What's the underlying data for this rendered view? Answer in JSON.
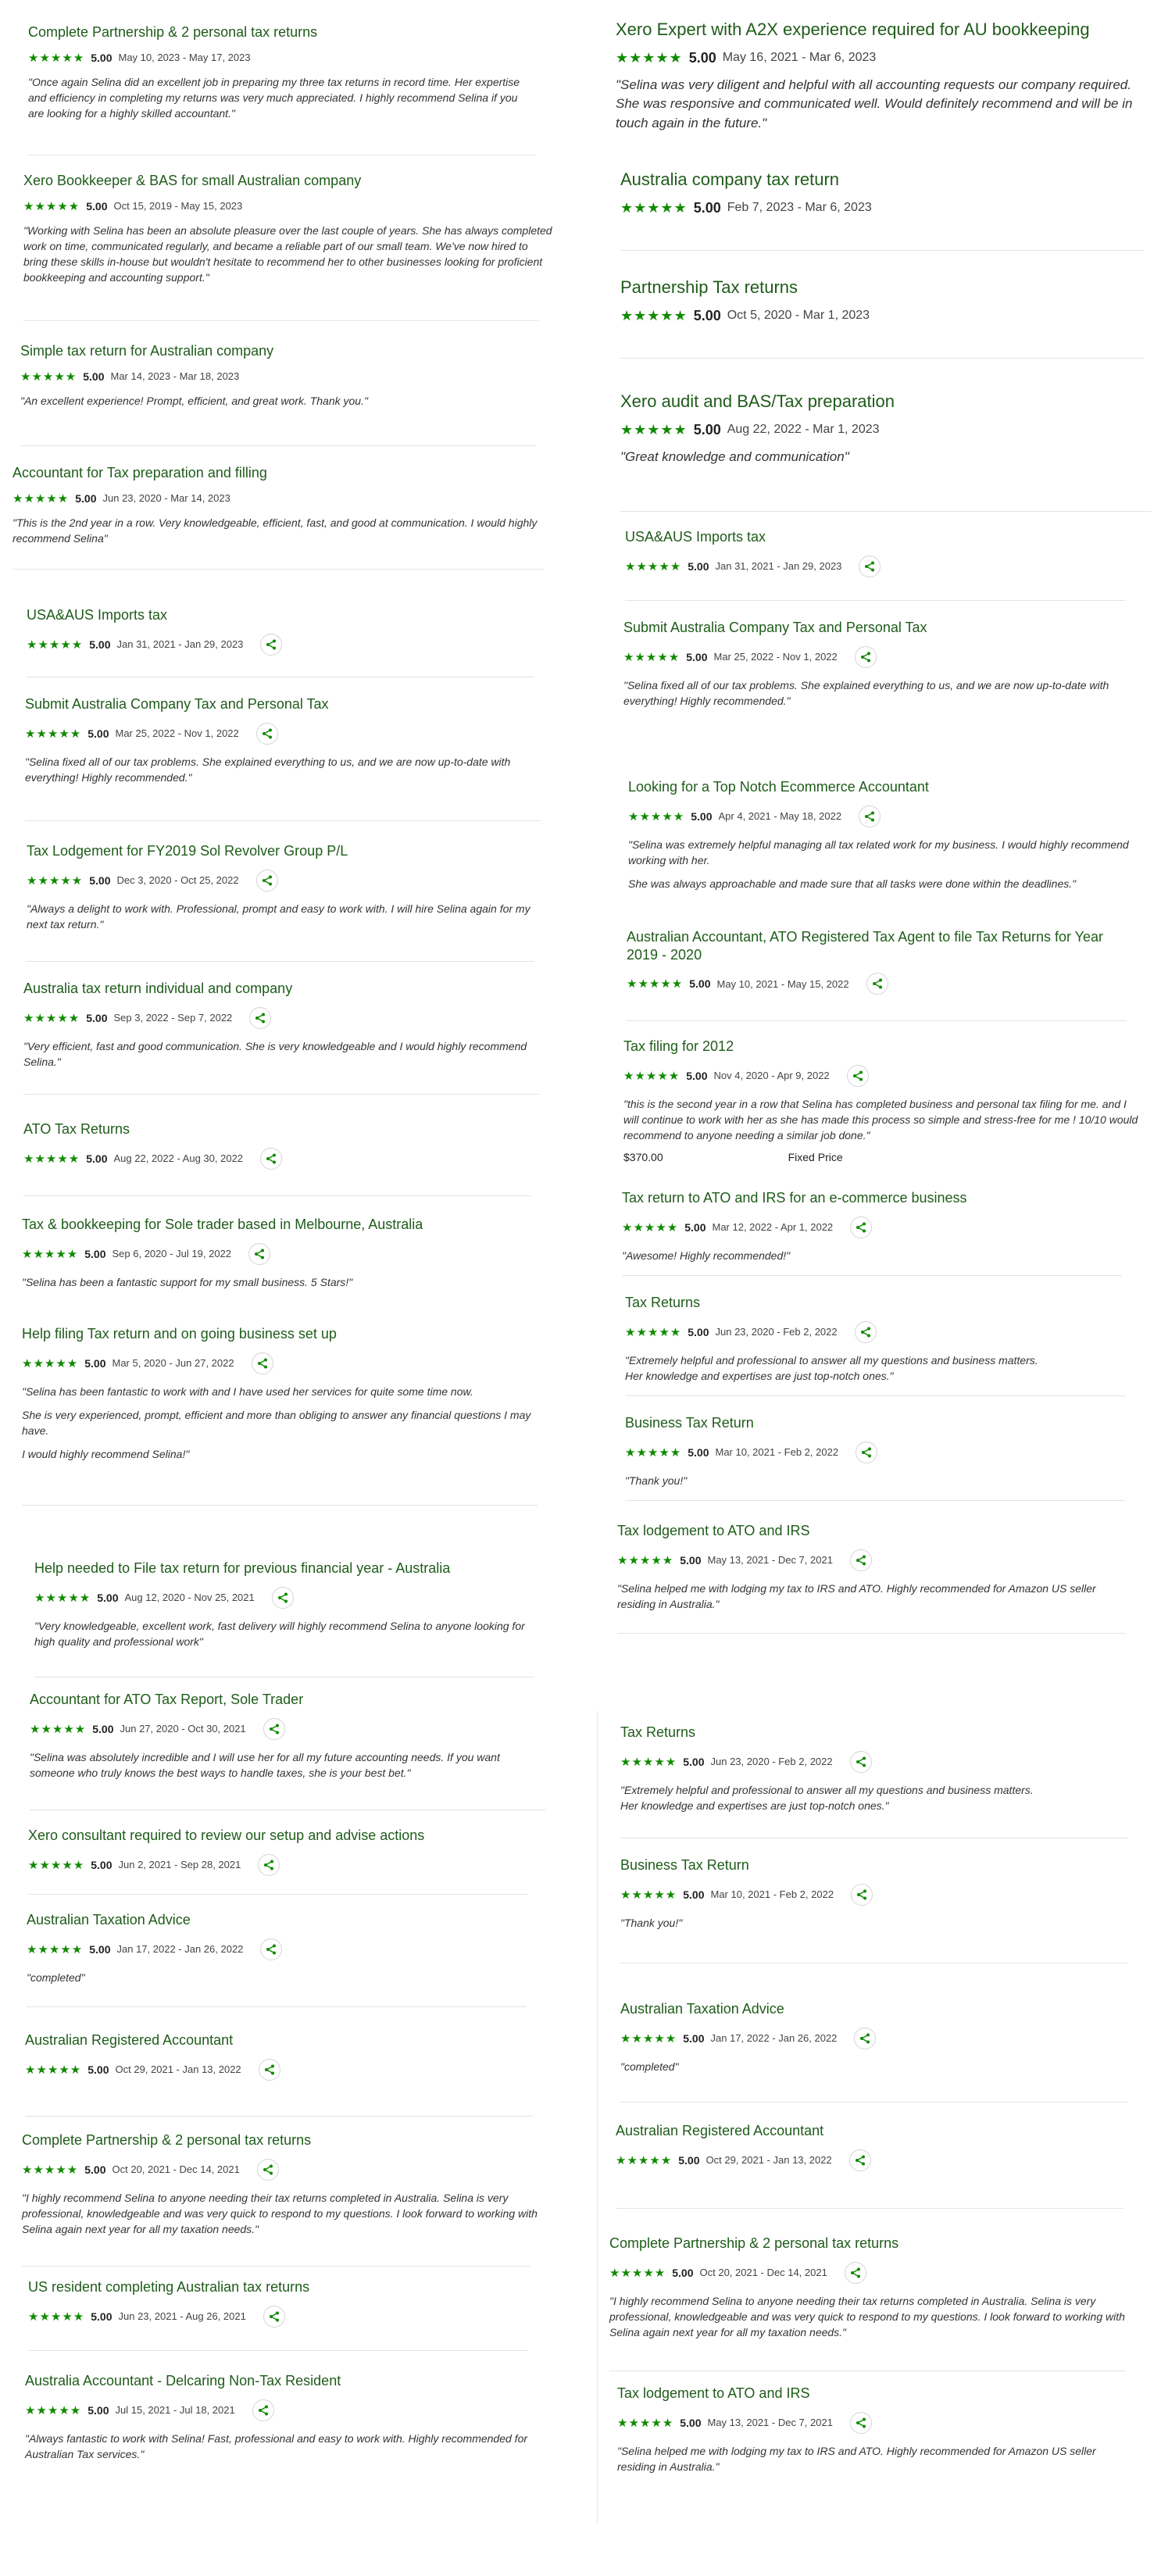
{
  "colors": {
    "accent": "#108a00",
    "title": "#1f5c1a"
  },
  "share_icon": "share-icon",
  "reviews": [
    {
      "title": "Complete Partnership & 2 personal tax returns",
      "stars": "★★★★★",
      "score": "5.00",
      "dates": "May 10, 2023 - May 17, 2023",
      "quote": "\"Once again Selina did an excellent job in preparing my three tax returns in record time. Her expertise and efficiency in completing my returns was very much appreciated. I highly recommend Selina if you are looking for a highly skilled accountant.\""
    },
    {
      "title": "Xero Bookkeeper & BAS for small Australian company",
      "stars": "★★★★★",
      "score": "5.00",
      "dates": "Oct 15, 2019 - May 15, 2023",
      "quote": "\"Working with Selina has been an absolute pleasure over the last couple of years. She has always completed work on time, communicated regularly, and became a reliable part of our small team. We've now hired to bring these skills in-house but wouldn't hesitate to recommend her to other businesses looking for proficient bookkeeping and accounting support.\""
    },
    {
      "title": "Simple tax return for Australian company",
      "stars": "★★★★★",
      "score": "5.00",
      "dates": "Mar 14, 2023 - Mar 18, 2023",
      "quote": "\"An excellent experience! Prompt, efficient, and great work. Thank you.\""
    },
    {
      "title": "Accountant for Tax preparation and filling",
      "stars": "★★★★★",
      "score": "5.00",
      "dates": "Jun 23, 2020 - Mar 14, 2023",
      "quote": "\"This is the 2nd year in a row. Very knowledgeable, efficient, fast, and good at communication. I would highly recommend Selina\""
    },
    {
      "title": "USA&AUS Imports tax",
      "stars": "★★★★★",
      "score": "5.00",
      "dates": "Jan 31, 2021 - Jan 29, 2023"
    },
    {
      "title": "Submit Australia Company Tax and Personal Tax",
      "stars": "★★★★★",
      "score": "5.00",
      "dates": "Mar 25, 2022 - Nov 1, 2022",
      "quote": "\"Selina fixed all of our tax problems. She explained everything to us, and we are now up-to-date with everything! Highly recommended.\""
    },
    {
      "title": "Tax Lodgement for FY2019 Sol Revolver Group P/L",
      "stars": "★★★★★",
      "score": "5.00",
      "dates": "Dec 3, 2020 - Oct 25, 2022",
      "quote": "\"Always a delight to work with. Professional, prompt and easy to work with. I will hire Selina again for my next tax return.\""
    },
    {
      "title": "Australia tax return individual and company",
      "stars": "★★★★★",
      "score": "5.00",
      "dates": "Sep 3, 2022 - Sep 7, 2022",
      "quote": "\"Very efficient, fast and good communication. She is very knowledgeable and I would highly recommend Selina.\""
    },
    {
      "title": "ATO Tax Returns",
      "stars": "★★★★★",
      "score": "5.00",
      "dates": "Aug 22, 2022 - Aug 30, 2022"
    },
    {
      "title": "Tax & bookkeeping for Sole trader based in Melbourne, Australia",
      "stars": "★★★★★",
      "score": "5.00",
      "dates": "Sep 6, 2020 - Jul 19, 2022",
      "quote": "\"Selina has been a fantastic support for my small business. 5 Stars!\""
    },
    {
      "title": "Help filing Tax return and on going business set up",
      "stars": "★★★★★",
      "score": "5.00",
      "dates": "Mar 5, 2020 - Jun 27, 2022",
      "quote": "\"Selina has been fantastic to work with and I have used her services for quite some time now.",
      "quote2": "She is very experienced, prompt, efficient and more than obliging to answer any financial questions I may have.",
      "quote3": "I would highly recommend Selina!\""
    },
    {
      "title": "Help needed to File tax return for previous financial year - Australia",
      "stars": "★★★★★",
      "score": "5.00",
      "dates": "Aug 12, 2020 - Nov 25, 2021",
      "quote": "\"Very knowledgeable, excellent work, fast delivery will highly recommend Selina to anyone looking for high quality and professional work\""
    },
    {
      "title": "Accountant for ATO Tax Report, Sole Trader",
      "stars": "★★★★★",
      "score": "5.00",
      "dates": "Jun 27, 2020 - Oct 30, 2021",
      "quote": "\"Selina was absolutely incredible and I will use her for all my future accounting needs. If you want someone who truly knows the best ways to handle taxes, she is your best bet.\""
    },
    {
      "title": "Xero consultant required to review our setup and advise actions",
      "stars": "★★★★★",
      "score": "5.00",
      "dates": "Jun 2, 2021 - Sep 28, 2021"
    },
    {
      "title": "Australian Taxation Advice",
      "stars": "★★★★★",
      "score": "5.00",
      "dates": "Jan 17, 2022 - Jan 26, 2022",
      "quote": "\"completed\""
    },
    {
      "title": "Australian Registered Accountant",
      "stars": "★★★★★",
      "score": "5.00",
      "dates": "Oct 29, 2021 - Jan 13, 2022"
    },
    {
      "title": "Complete Partnership & 2 personal tax returns",
      "stars": "★★★★★",
      "score": "5.00",
      "dates": "Oct 20, 2021 - Dec 14, 2021",
      "quote": "\"I highly recommend Selina to anyone needing their tax returns completed in Australia. Selina is very professional, knowledgeable and was very quick to respond to my questions. I look forward to working with Selina again next year for all my taxation needs.\""
    },
    {
      "title": "US resident completing Australian tax returns",
      "stars": "★★★★★",
      "score": "5.00",
      "dates": "Jun 23, 2021 - Aug 26, 2021"
    },
    {
      "title": "Australia Accountant - Delcaring Non-Tax Resident",
      "stars": "★★★★★",
      "score": "5.00",
      "dates": "Jul 15, 2021 - Jul 18, 2021",
      "quote": "\"Always fantastic to work with Selina! Fast, professional and easy to work with. Highly recommended for Australian Tax services.\""
    },
    {
      "title": "Xero Expert with A2X experience required for AU bookkeeping",
      "stars": "★★★★★",
      "score": "5.00",
      "dates": "May 16, 2021 - Mar 6, 2023",
      "quote": "\"Selina was very diligent and helpful with all accounting requests our company required. She was responsive and communicated well. Would definitely recommend and will be in touch again in the future.\""
    },
    {
      "title": "Australia company tax return",
      "stars": "★★★★★",
      "score": "5.00",
      "dates": "Feb 7, 2023 - Mar 6, 2023"
    },
    {
      "title": "Partnership Tax returns",
      "stars": "★★★★★",
      "score": "5.00",
      "dates": "Oct 5, 2020 - Mar 1, 2023"
    },
    {
      "title": "Xero audit and BAS/Tax preparation",
      "stars": "★★★★★",
      "score": "5.00",
      "dates": "Aug 22, 2022 - Mar 1, 2023",
      "quote": "\"Great knowledge and communication\""
    },
    {
      "title": "USA&AUS Imports tax",
      "stars": "★★★★★",
      "score": "5.00",
      "dates": "Jan 31, 2021 - Jan 29, 2023"
    },
    {
      "title": "Submit Australia Company Tax and Personal Tax",
      "stars": "★★★★★",
      "score": "5.00",
      "dates": "Mar 25, 2022 - Nov 1, 2022",
      "quote": "\"Selina fixed all of our tax problems. She explained everything to us, and we are now up-to-date with everything! Highly recommended.\""
    },
    {
      "title": "Looking for a Top Notch Ecommerce Accountant",
      "stars": "★★★★★",
      "score": "5.00",
      "dates": "Apr 4, 2021 - May 18, 2022",
      "quote": "\"Selina was extremely helpful managing all tax related work for my business. I would highly recommend working with her.",
      "quote2": "She was always approachable and made sure that all tasks were done within the deadlines.\""
    },
    {
      "title": "Australian Accountant, ATO Registered Tax Agent to file Tax Returns for Year 2019 - 2020",
      "stars": "★★★★★",
      "score": "5.00",
      "dates": "May 10, 2021 - May 15, 2022"
    },
    {
      "title": "Tax filing for 2012",
      "stars": "★★★★★",
      "score": "5.00",
      "dates": "Nov 4, 2020 - Apr 9, 2022",
      "quote": "\"this is the second year in a row that Selina has completed business and personal tax filing for me. and I will continue to work with her as she has made this process so simple and stress-free for me ! 10/10 would recommend to anyone needing a similar job done.\"",
      "price": "$370.00",
      "price_type": "Fixed Price"
    },
    {
      "title": "Tax return to ATO and IRS for an e-commerce business",
      "stars": "★★★★★",
      "score": "5.00",
      "dates": "Mar 12, 2022 - Apr 1, 2022",
      "quote": "\"Awesome! Highly recommended!\""
    },
    {
      "title": "Tax Returns",
      "stars": "★★★★★",
      "score": "5.00",
      "dates": "Jun 23, 2020 - Feb 2, 2022",
      "quote": "\"Extremely helpful and professional to answer all my questions and business matters.",
      "quote2": "Her knowledge and expertises are just top-notch ones.\""
    },
    {
      "title": "Business Tax Return",
      "stars": "★★★★★",
      "score": "5.00",
      "dates": "Mar 10, 2021 - Feb 2, 2022",
      "quote": "\"Thank you!\""
    },
    {
      "title": "Tax lodgement to ATO and IRS",
      "stars": "★★★★★",
      "score": "5.00",
      "dates": "May 13, 2021 - Dec 7, 2021",
      "quote": "\"Selina helped me with lodging my tax to IRS and ATO. Highly recommended for Amazon US seller residing in Australia.\""
    },
    {
      "title": "Tax Returns",
      "stars": "★★★★★",
      "score": "5.00",
      "dates": "Jun 23, 2020 - Feb 2, 2022",
      "quote": "\"Extremely helpful and professional to answer all my questions and business matters.",
      "quote2": "Her knowledge and expertises are just top-notch ones.\""
    },
    {
      "title": "Business Tax Return",
      "stars": "★★★★★",
      "score": "5.00",
      "dates": "Mar 10, 2021 - Feb 2, 2022",
      "quote": "\"Thank you!\""
    },
    {
      "title": "Australian Taxation Advice",
      "stars": "★★★★★",
      "score": "5.00",
      "dates": "Jan 17, 2022 - Jan 26, 2022",
      "quote": "\"completed\""
    },
    {
      "title": "Australian Registered Accountant",
      "stars": "★★★★★",
      "score": "5.00",
      "dates": "Oct 29, 2021 - Jan 13, 2022"
    },
    {
      "title": "Complete Partnership & 2 personal tax returns",
      "stars": "★★★★★",
      "score": "5.00",
      "dates": "Oct 20, 2021 - Dec 14, 2021",
      "quote": "\"I highly recommend Selina to anyone needing their tax returns completed in Australia. Selina is very professional, knowledgeable and was very quick to respond to my questions. I look forward to working with Selina again next year for all my taxation needs.\""
    },
    {
      "title": "Tax lodgement to ATO and IRS",
      "stars": "★★★★★",
      "score": "5.00",
      "dates": "May 13, 2021 - Dec 7, 2021",
      "quote": "\"Selina helped me with lodging my tax to IRS and ATO. Highly recommended for Amazon US seller residing in Australia.\""
    }
  ]
}
